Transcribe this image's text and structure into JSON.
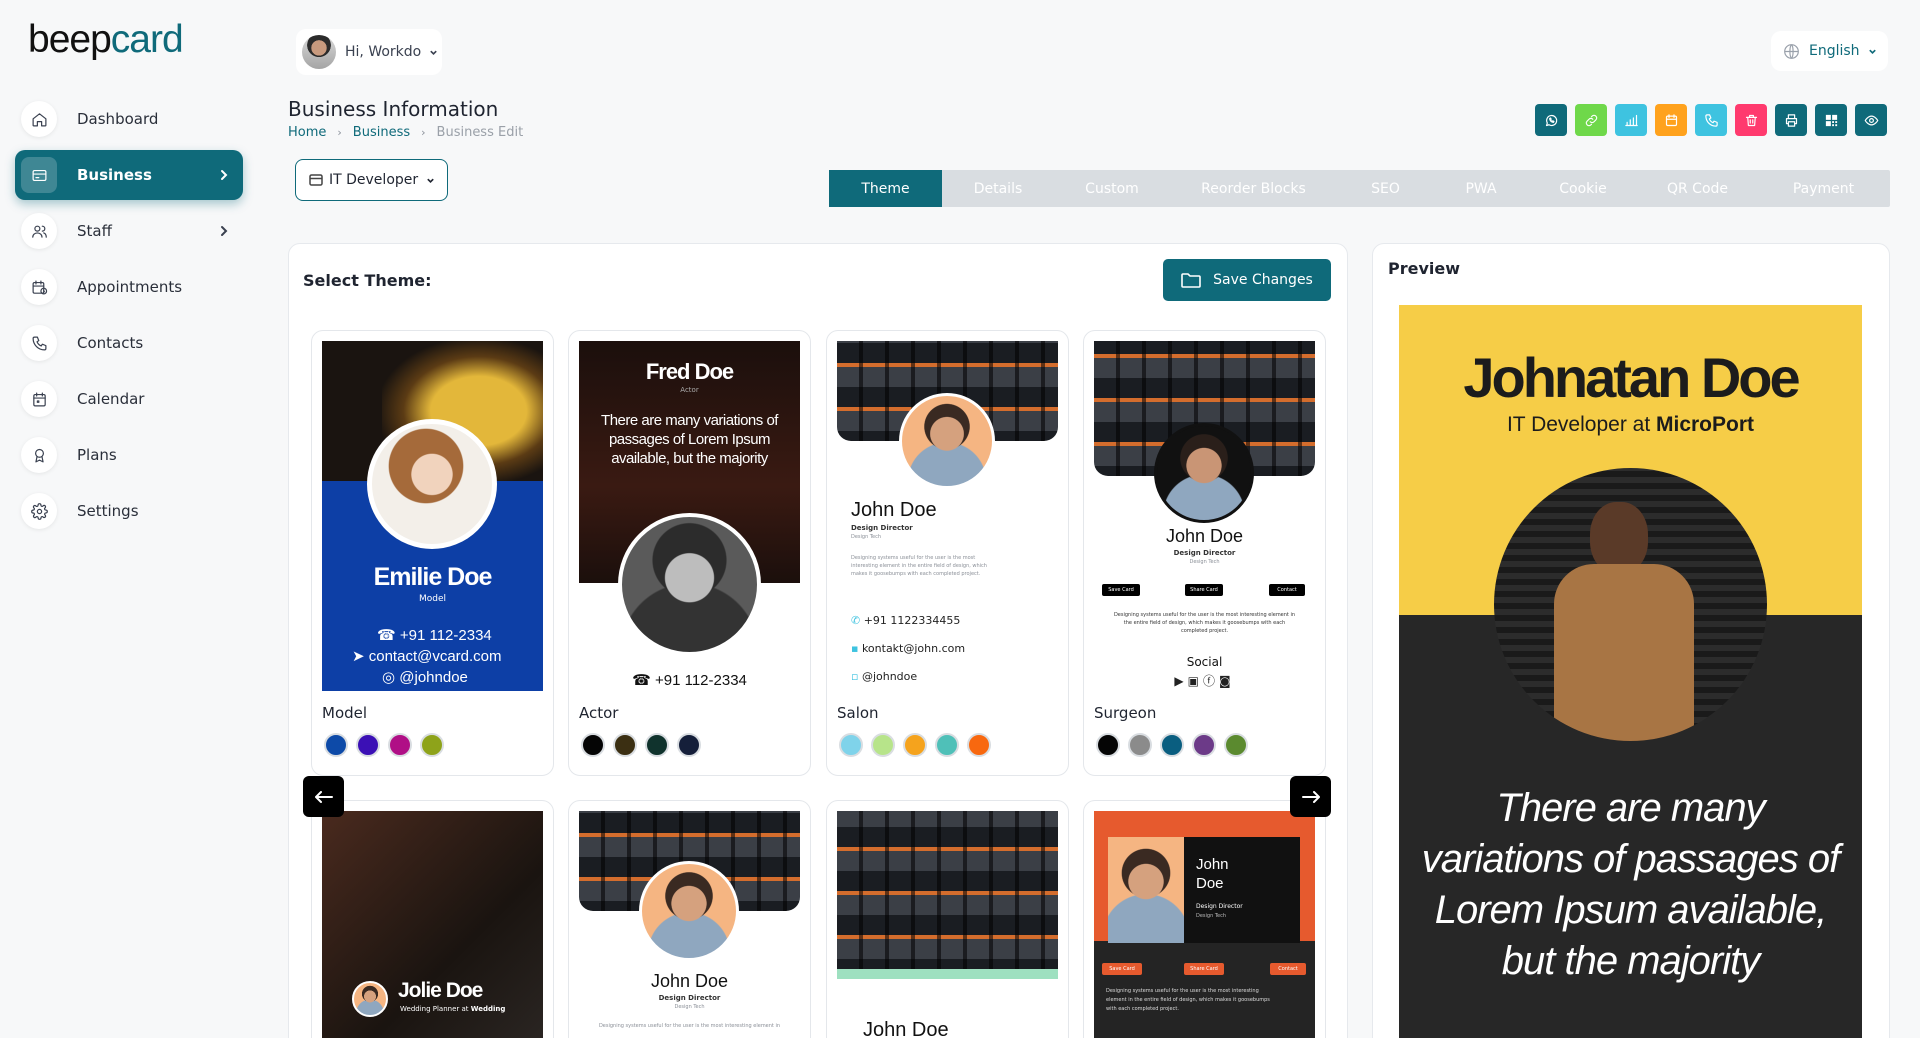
{
  "brand": {
    "part1": "beep",
    "part2": "card"
  },
  "sidebar": {
    "items": [
      {
        "label": "Dashboard",
        "icon": "home-icon",
        "active": false,
        "has_chevron": false
      },
      {
        "label": "Business",
        "icon": "card-icon",
        "active": true,
        "has_chevron": true
      },
      {
        "label": "Staff",
        "icon": "users-icon",
        "active": false,
        "has_chevron": true
      },
      {
        "label": "Appointments",
        "icon": "calendar-clock-icon",
        "active": false,
        "has_chevron": false
      },
      {
        "label": "Contacts",
        "icon": "phone-icon",
        "active": false,
        "has_chevron": false
      },
      {
        "label": "Calendar",
        "icon": "calendar-icon",
        "active": false,
        "has_chevron": false
      },
      {
        "label": "Plans",
        "icon": "award-icon",
        "active": false,
        "has_chevron": false
      },
      {
        "label": "Settings",
        "icon": "gear-icon",
        "active": false,
        "has_chevron": false
      }
    ]
  },
  "header": {
    "greeting": "Hi, Workdo",
    "language": "English",
    "title": "Business Information",
    "breadcrumb": [
      "Home",
      "Business",
      "Business Edit"
    ]
  },
  "toolbar": [
    {
      "icon": "whatsapp-icon",
      "color": "#0f6a7a"
    },
    {
      "icon": "link-icon",
      "color": "#6fd84a"
    },
    {
      "icon": "analytics-icon",
      "color": "#3ec3e0"
    },
    {
      "icon": "calendar-icon",
      "color": "#ffa21d"
    },
    {
      "icon": "phone-icon",
      "color": "#3ec3e0"
    },
    {
      "icon": "trash-icon",
      "color": "#ff3a6e"
    },
    {
      "icon": "printer-icon",
      "color": "#0f6a7a"
    },
    {
      "icon": "qr-icon",
      "color": "#0f6a7a"
    },
    {
      "icon": "eye-icon",
      "color": "#0f6a7a"
    }
  ],
  "business_select": {
    "value": "IT Developer"
  },
  "tabs": [
    "Theme",
    "Details",
    "Custom",
    "Reorder Blocks",
    "SEO",
    "PWA",
    "Cookie",
    "QR Code",
    "Payment"
  ],
  "active_tab": "Theme",
  "theme_panel": {
    "label": "Select Theme:",
    "save_label": "Save Changes",
    "themes": [
      {
        "name": "Model",
        "colors": [
          "#0d4aa8",
          "#3b10b5",
          "#b00f86",
          "#8ea31a"
        ]
      },
      {
        "name": "Actor",
        "colors": [
          "#050505",
          "#3b2f12",
          "#10332d",
          "#151f3a"
        ]
      },
      {
        "name": "Salon",
        "colors": [
          "#7fd3ea",
          "#b7e48a",
          "#f5a31d",
          "#4fc0b8",
          "#f8680f"
        ]
      },
      {
        "name": "Surgeon",
        "colors": [
          "#050505",
          "#8b8b8b",
          "#0a5e80",
          "#6c3a88",
          "#5b8a2f"
        ]
      }
    ],
    "cards": {
      "model": {
        "name": "Emilie Doe",
        "role": "Model",
        "phone": "+91 112-2334",
        "email": "contact@vcard.com",
        "handle": "@johndoe"
      },
      "actor": {
        "name": "Fred Doe",
        "role": "Actor",
        "quote": "There are many variations of passages of Lorem Ipsum available, but the majority",
        "phone": "+91 112-2334"
      },
      "salon": {
        "name": "John Doe",
        "role": "Design Director",
        "sub": "Design Tech",
        "body": "Designing systems useful for the user is the most interesting element in the entire field of design, which makes it goosebumps with each completed project.",
        "phone": "+91 1122334455",
        "email": "kontakt@john.com",
        "handle": "@johndoe"
      },
      "surgeon": {
        "name": "John Doe",
        "role": "Design Director",
        "sub": "Design Tech",
        "btns": [
          "Save Card",
          "Share Card",
          "Contact"
        ],
        "body": "Designing systems useful for the user is the most interesting element in the entire field of design, which makes it goosebumps with each completed project.",
        "social": "Social"
      },
      "row2a": {
        "name": "Jolie Doe",
        "role": "Wedding Planner at",
        "company": "Wedding"
      },
      "row2b": {
        "name": "John Doe",
        "role": "Design Director",
        "sub": "Design Tech",
        "body": "Designing systems useful for the user is the most interesting element in"
      },
      "row2c": {
        "name": "John Doe"
      },
      "row2d": {
        "first": "John",
        "last": "Doe",
        "role": "Design Director",
        "sub": "Design Tech",
        "btns": [
          "Save Card",
          "Share Card",
          "Contact"
        ],
        "body": "Designing systems useful for the user is the most interesting element in the entire field of design, which makes it goosebumps with each completed project."
      }
    }
  },
  "preview": {
    "label": "Preview",
    "name": "Johnatan Doe",
    "role_prefix": "IT Developer at",
    "company": "MicroPort",
    "quote": "There are many variations of passages of Lorem Ipsum available, but the majority"
  }
}
